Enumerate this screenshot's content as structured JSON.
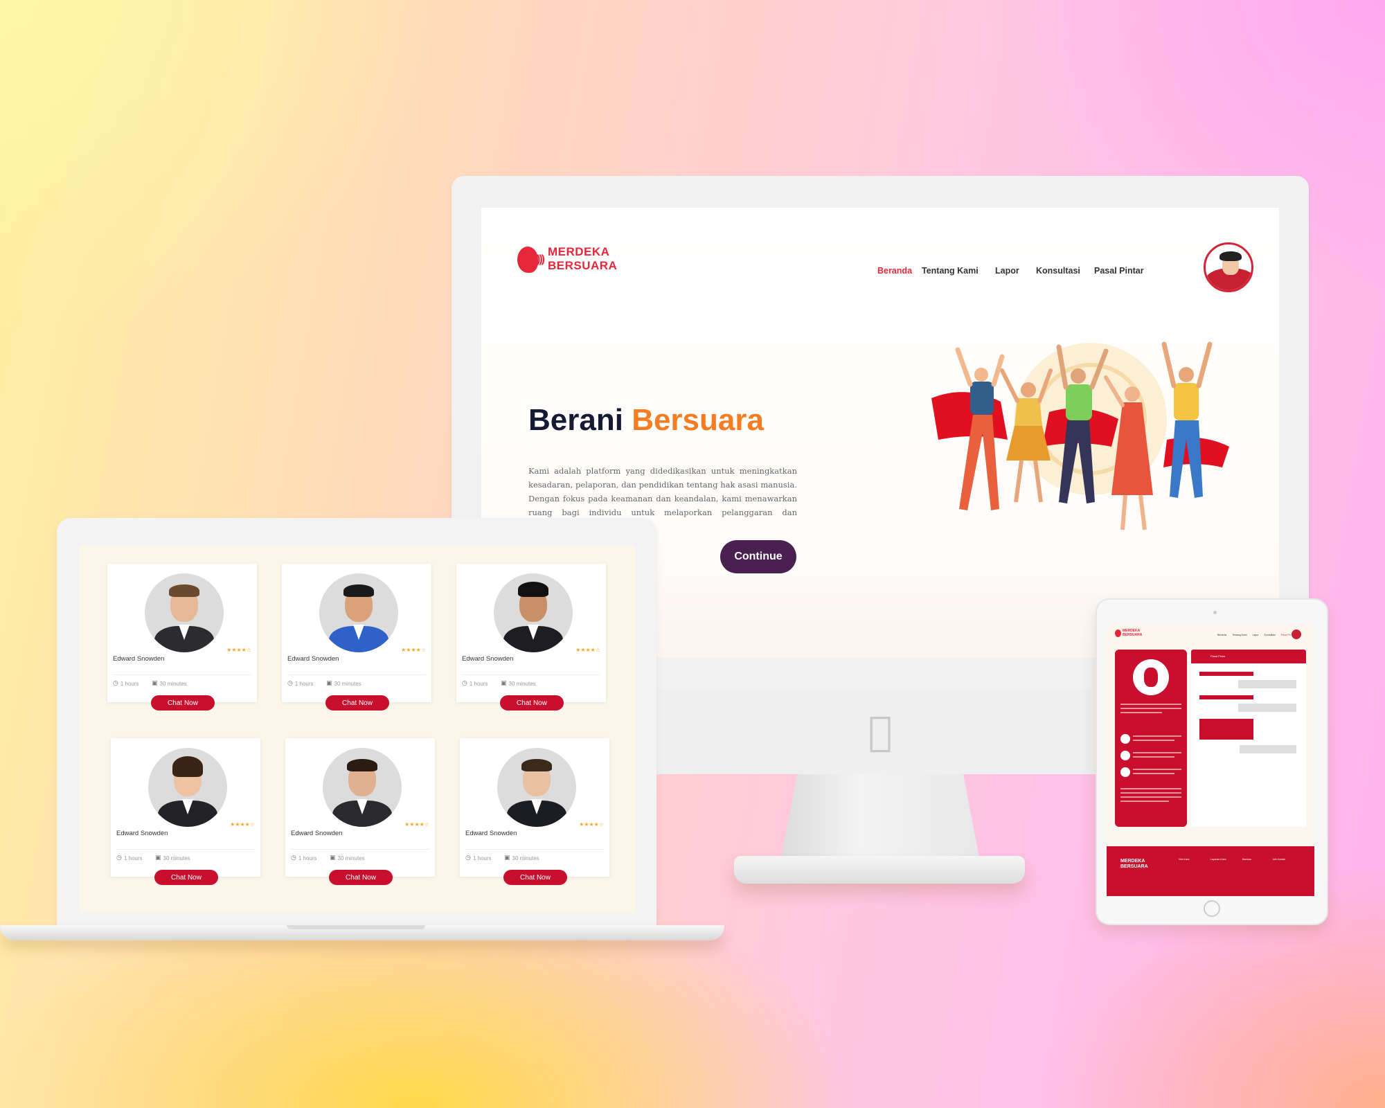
{
  "desktop": {
    "logo": {
      "line1": "MERDEKA",
      "line2": "BERSUARA"
    },
    "nav": [
      "Beranda",
      "Tentang Kami",
      "Lapor",
      "Konsultasi",
      "Pasal Pintar"
    ],
    "hero": {
      "title_part1": "Berani",
      "title_part2": "Bersuara",
      "description": "Kami adalah platform yang didedikasikan untuk meningkatkan kesadaran, pelaporan, dan pendidikan tentang hak asasi manusia. Dengan fokus pada keamanan dan keandalan, kami menawarkan ruang bagi individu untuk melaporkan pelanggaran dan mengakses ...ik.",
      "cta": "Continue"
    }
  },
  "laptop": {
    "cards": [
      {
        "name": "Edward Snowden",
        "rating": "★★★★☆",
        "hours": "1 hours",
        "duration": "30 minutes",
        "cta": "Chat Now"
      },
      {
        "name": "Edward Snowden",
        "rating": "★★★★☆",
        "hours": "1 hours",
        "duration": "30 minutes",
        "cta": "Chat Now"
      },
      {
        "name": "Edward Snowden",
        "rating": "★★★★☆",
        "hours": "1 hours",
        "duration": "30 minutes",
        "cta": "Chat Now"
      },
      {
        "name": "Edward Snowden",
        "rating": "★★★★☆",
        "hours": "1 hours",
        "duration": "30 minutes",
        "cta": "Chat Now"
      },
      {
        "name": "Edward Snowden",
        "rating": "★★★★☆",
        "hours": "1 hours",
        "duration": "30 minutes",
        "cta": "Chat Now"
      },
      {
        "name": "Edward Snowden",
        "rating": "★★★★☆",
        "hours": "1 hours",
        "duration": "30 minutes",
        "cta": "Chat Now"
      }
    ]
  },
  "tablet": {
    "logo": {
      "line1": "MERDEKA",
      "line2": "BERSUARA"
    },
    "nav": [
      "Beranda",
      "Tentang Kami",
      "Lapor",
      "Konsultasi",
      "Pasal Pintar"
    ],
    "chat_title": "Pasal Pintar",
    "footer_logo": {
      "line1": "MERDEKA",
      "line2": "BERSUARA"
    },
    "footer_cols": [
      "Hub Kami",
      "Layanan Kami",
      "Bantuan",
      "Info Kontak"
    ]
  },
  "colors": {
    "brand_red": "#c8102e",
    "accent_orange": "#f57c20",
    "cta_purple": "#4a2050",
    "star": "#f5a623"
  },
  "icons": [
    "apple-icon",
    "clock-icon",
    "video-icon",
    "star-icon",
    "robot-icon"
  ]
}
